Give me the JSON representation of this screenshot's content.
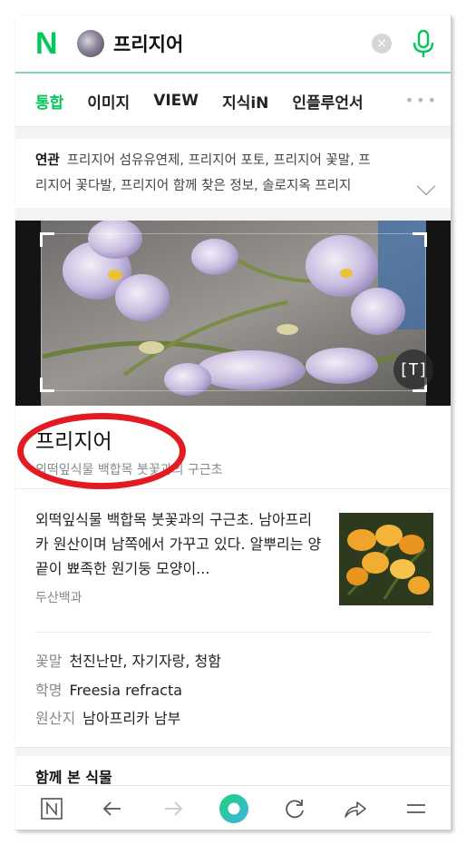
{
  "search": {
    "logo": "N",
    "query": "프리지어",
    "clear_icon": "×"
  },
  "tabs": [
    {
      "label": "통합",
      "active": true
    },
    {
      "label": "이미지",
      "active": false
    },
    {
      "label": "VIEW",
      "active": false
    },
    {
      "label": "지식iN",
      "active": false
    },
    {
      "label": "인플루언서",
      "active": false
    }
  ],
  "tabs_more": "•••",
  "related": {
    "heading": "연관",
    "line1": "프리지어 섬유유연제, 프리지어 포토, 프리지어 꽃말, 프",
    "line2": "리지어 꽃다발, 프리지어 함께 찾은 정보, 솔로지옥 프리지"
  },
  "hero": {
    "ocr_label": "[T]"
  },
  "entry": {
    "title": "프리지어",
    "subtitle": "외떡잎식물 백합목 붓꽃과의 구근초"
  },
  "description": {
    "text": "외떡잎식물 백합목 붓꽃과의 구근초. 남아프리카 원산이며 남쪽에서 가꾸고 있다. 알뿌리는 양 끝이 뾰족한 원기둥 모양이...",
    "source": "두산백과"
  },
  "info": [
    {
      "key": "꽃말",
      "value": "천진난만, 자기자랑, 청함"
    },
    {
      "key": "학명",
      "value": "Freesia refracta"
    },
    {
      "key": "원산지",
      "value": "남아프리카 남부"
    }
  ],
  "seen_together": "함께 본 식물",
  "colors": {
    "brand": "#03c75a",
    "annotation": "#e21b23"
  },
  "bottom_nav": [
    "home-n-icon",
    "back-icon",
    "forward-icon",
    "greendot-icon",
    "refresh-icon",
    "share-icon",
    "menu-icon"
  ]
}
